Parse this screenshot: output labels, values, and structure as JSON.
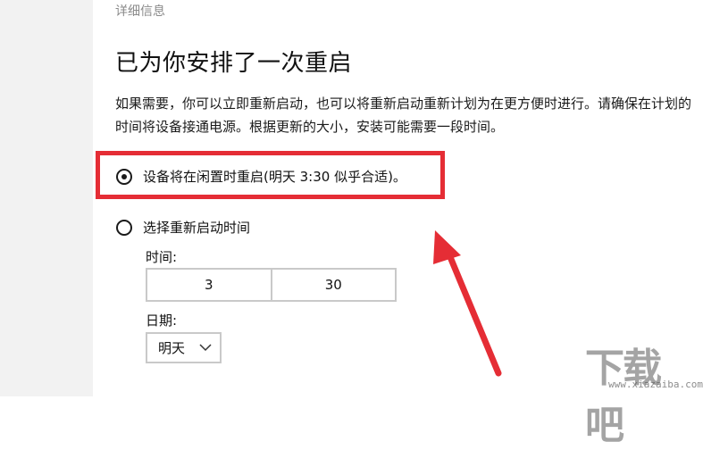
{
  "breadcrumb": "详细信息",
  "title": "已为你安排了一次重启",
  "description": "如果需要，你可以立即重新启动，也可以将重新启动重新计划为在更方便时进行。请确保在计划的时间将设备接通电源。根据更新的大小，安装可能需要一段时间。",
  "options": {
    "auto_restart": {
      "label": "设备将在闲置时重启(明天 3:30 似乎合适)。",
      "checked": true
    },
    "pick_time": {
      "label": "选择重新启动时间",
      "checked": false
    }
  },
  "time_label": "时间:",
  "time": {
    "hour": "3",
    "minute": "30"
  },
  "date_label": "日期:",
  "date_value": "明天",
  "watermark": {
    "text": "下载吧",
    "url": "www.xiazaiba.com"
  },
  "colors": {
    "highlight": "#e52d35",
    "arrow": "#e52d35"
  },
  "icons": {
    "radio_checked": "radio-checked-icon",
    "radio_unchecked": "radio-unchecked-icon",
    "dropdown": "chevron-down-icon"
  }
}
